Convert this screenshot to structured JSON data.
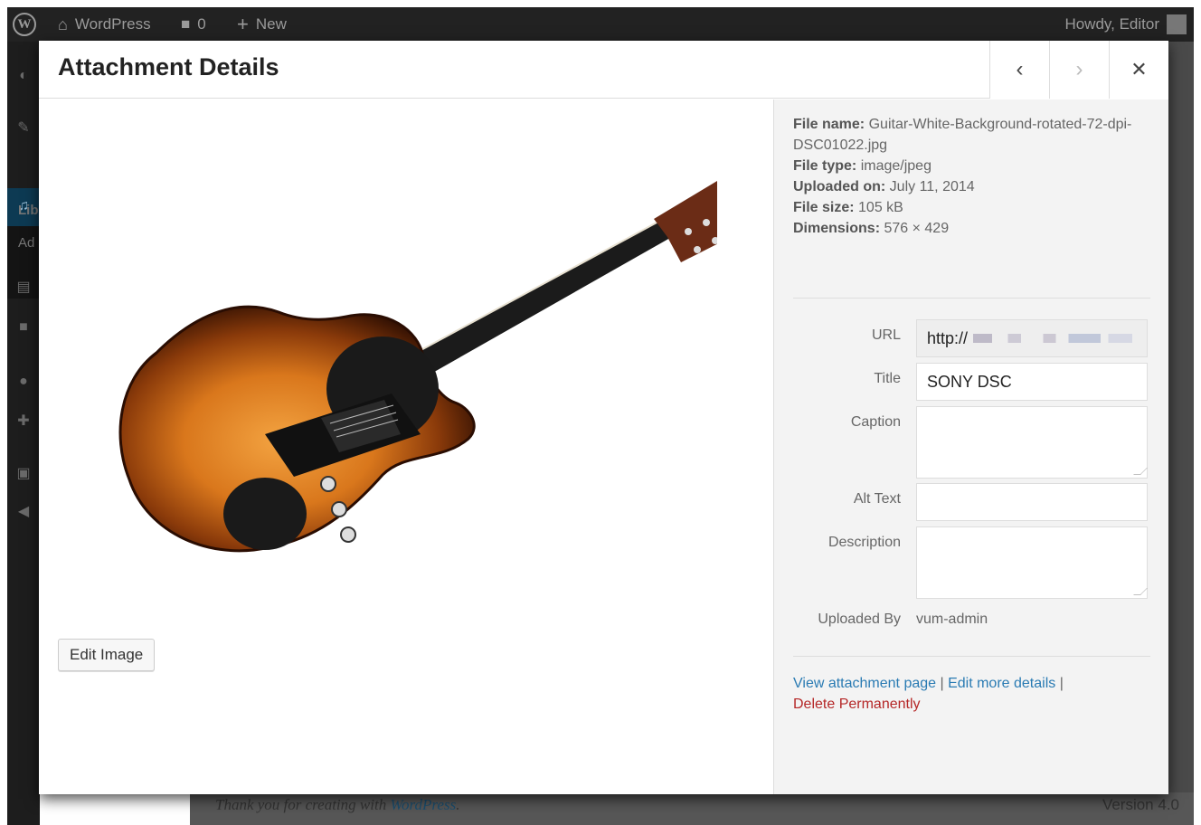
{
  "adminbar": {
    "site_name": "WordPress",
    "comments_count": "0",
    "new_label": "New",
    "greeting": "Howdy, Editor"
  },
  "sidebar": {
    "label_lib": "Lib",
    "label_add": "Ad"
  },
  "footer": {
    "thanks_prefix": "Thank you for creating with ",
    "thanks_link": "WordPress",
    "thanks_suffix": ".",
    "version": "Version 4.0"
  },
  "modal": {
    "title": "Attachment Details",
    "prev_icon": "chevron-left-icon",
    "next_icon": "chevron-right-icon",
    "close_icon": "close-icon"
  },
  "image": {
    "alt": "Sunburst electric guitar",
    "edit_button": "Edit Image"
  },
  "details": {
    "file_name_label": "File name:",
    "file_name": "Guitar-White-Background-rotated-72-dpi-DSC01022.jpg",
    "file_type_label": "File type:",
    "file_type": "image/jpeg",
    "uploaded_on_label": "Uploaded on:",
    "uploaded_on": "July 11, 2014",
    "file_size_label": "File size:",
    "file_size": "105 kB",
    "dimensions_label": "Dimensions:",
    "dimensions": "576 × 429",
    "url_label": "URL",
    "url_value": "http://",
    "title_label": "Title",
    "title_value": "SONY DSC",
    "caption_label": "Caption",
    "caption_value": "",
    "alt_label": "Alt Text",
    "alt_value": "",
    "description_label": "Description",
    "description_value": "",
    "uploaded_by_label": "Uploaded By",
    "uploaded_by_value": "vum-admin"
  },
  "actions": {
    "view_page": "View attachment page",
    "sep1": " | ",
    "edit_details": "Edit more details",
    "sep2": " |",
    "delete": "Delete Permanently"
  }
}
